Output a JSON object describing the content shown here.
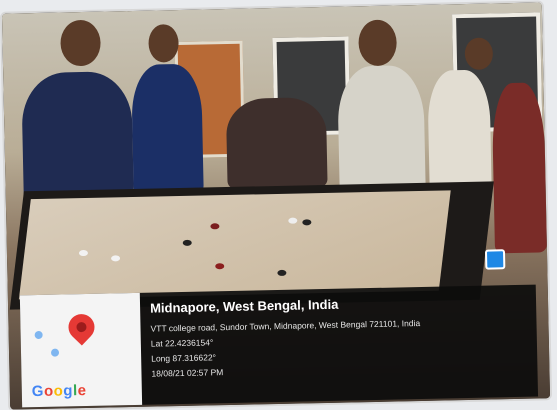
{
  "geotag": {
    "title": "Midnapore, West Bengal, India",
    "address": "VTT college road, Sundor Town, Midnapore, West Bengal 721101, India",
    "lat": "Lat 22.4236154°",
    "long": "Long 87.316622°",
    "timestamp": "18/08/21 02:57 PM",
    "map_logo": "Google"
  },
  "colors": {
    "pin": "#e53935",
    "card": "#0c0c0c",
    "map_bg": "#f4f4f4"
  },
  "icons": {
    "pin": "map-pin-icon",
    "camera_badge": "camera-badge-icon"
  }
}
